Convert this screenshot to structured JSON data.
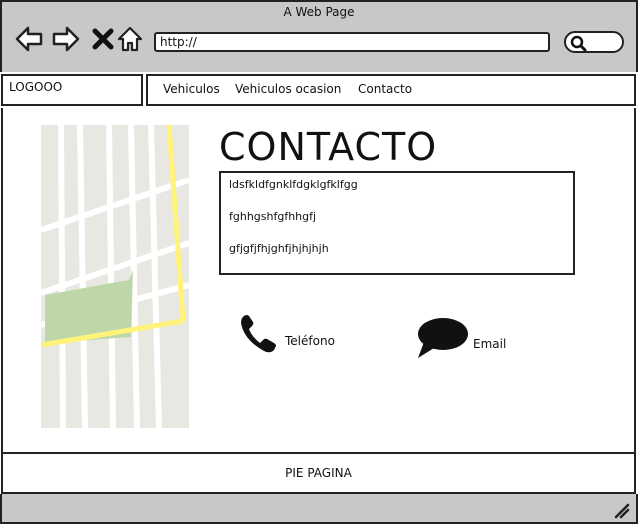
{
  "browser": {
    "title": "A Web Page",
    "url": "http://",
    "icons": [
      "back-arrow-icon",
      "forward-arrow-icon",
      "close-x-icon",
      "home-icon",
      "search-icon"
    ]
  },
  "nav": {
    "logo": "LOGOOO",
    "items": [
      "Vehiculos",
      "Vehiculos ocasion",
      "Contacto"
    ]
  },
  "content": {
    "heading": "CONTACTO",
    "lines": [
      "ldsfkldfgnklfdgklgfklfgg",
      "fghhgshfgfhhgfj",
      "gfjgfjfhjghfjhjhjhjh"
    ],
    "phone_label": "Teléfono",
    "email_label": "Email"
  },
  "footer": {
    "text": "PIE PAGINA"
  },
  "colors": {
    "chrome": "#c8c8c8",
    "map_bg": "#e9e7e1",
    "map_green": "#bdd7a8",
    "map_road": "#fff37a"
  }
}
